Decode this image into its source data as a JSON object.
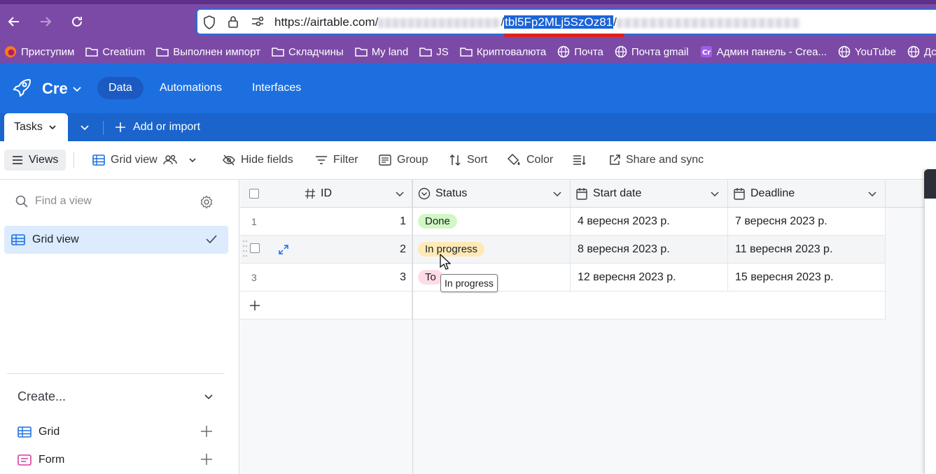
{
  "browser": {
    "url_prefix": "https://airtable.com/",
    "url_sep": "/",
    "url_selected": "tbl5Fp2MLj5SzOz81",
    "url_sep2": "/",
    "bookmarks": [
      {
        "label": "Приступим",
        "icon": "firefox-icon"
      },
      {
        "label": "Creatium",
        "icon": "folder-icon"
      },
      {
        "label": "Выполнен импорт",
        "icon": "folder-icon"
      },
      {
        "label": "Складчины",
        "icon": "folder-icon"
      },
      {
        "label": "My land",
        "icon": "folder-icon"
      },
      {
        "label": "JS",
        "icon": "folder-icon"
      },
      {
        "label": "Криптовалюта",
        "icon": "folder-icon"
      },
      {
        "label": "Почта",
        "icon": "globe-icon"
      },
      {
        "label": "Почта gmail",
        "icon": "globe-icon"
      },
      {
        "label": "Админ панель - Crea...",
        "icon": "creatium-icon"
      },
      {
        "label": "YouTube",
        "icon": "globe-icon"
      },
      {
        "label": "Дс",
        "icon": "globe-icon"
      }
    ]
  },
  "header": {
    "base_name": "Cre",
    "nav": [
      "Data",
      "Automations",
      "Interfaces"
    ]
  },
  "tablebar": {
    "tab": "Tasks",
    "add": "Add or import"
  },
  "toolbar": {
    "views": "Views",
    "grid_view": "Grid view",
    "hide_fields": "Hide fields",
    "filter": "Filter",
    "group": "Group",
    "sort": "Sort",
    "color": "Color",
    "share": "Share and sync"
  },
  "sidebar": {
    "find_placeholder": "Find a view",
    "active_view": "Grid view",
    "create_label": "Create...",
    "create_items": [
      "Grid",
      "Form"
    ]
  },
  "grid": {
    "columns": [
      "ID",
      "Status",
      "Start date",
      "Deadline"
    ],
    "rows": [
      {
        "num": "1",
        "id": "1",
        "status": "Done",
        "start": "4 вересня 2023 р.",
        "deadline": "7 вересня 2023 р."
      },
      {
        "num": "",
        "id": "2",
        "status": "In progress",
        "start": "8 вересня 2023 р.",
        "deadline": "11 вересня 2023 р."
      },
      {
        "num": "3",
        "id": "3",
        "status": "To",
        "start": "12 вересня 2023 р.",
        "deadline": "15 вересня 2023 р."
      }
    ],
    "tooltip": "In progress"
  },
  "colors": {
    "brand_blue": "#1d6fe0",
    "browser_purple": "#7b4aa6",
    "done_pill": "#d1f7c4",
    "progress_pill": "#ffeab6",
    "todo_pill": "#ffdce5"
  }
}
